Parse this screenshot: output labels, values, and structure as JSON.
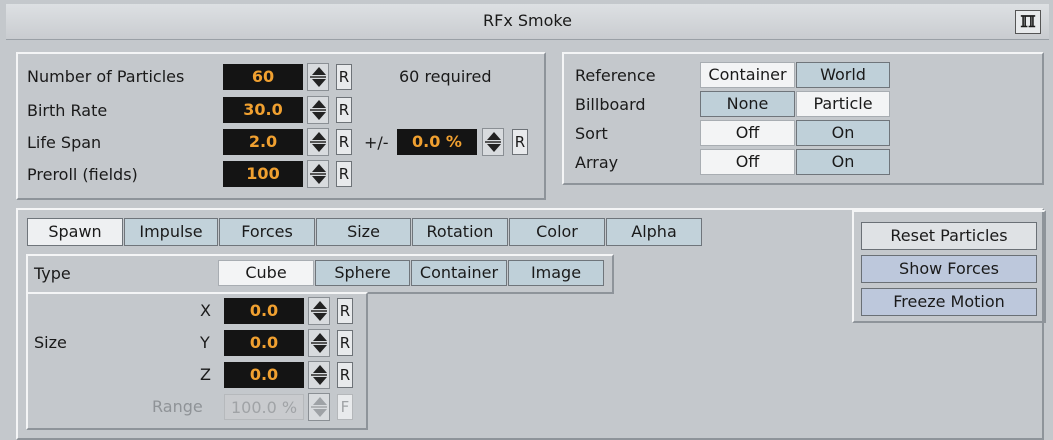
{
  "window": {
    "title": "RFx Smoke",
    "logo_glyph": "ℿ",
    "logo_icon": "vizrt-logo-icon"
  },
  "particles": {
    "rows": [
      {
        "label": "Number of Particles",
        "value": "60",
        "reset": "R"
      },
      {
        "label": "Birth Rate",
        "value": "30.0",
        "reset": "R"
      },
      {
        "label": "Life Span",
        "value": "2.0",
        "reset": "R"
      },
      {
        "label": "Preroll (fields)",
        "value": "100",
        "reset": "R"
      }
    ],
    "required_text": "60 required",
    "variance_label": "+/-",
    "variance_value": "0.0 %",
    "variance_reset": "R"
  },
  "options": {
    "rows": [
      {
        "label": "Reference",
        "a": "Container",
        "b": "World",
        "selected": "a"
      },
      {
        "label": "Billboard",
        "a": "None",
        "b": "Particle",
        "selected": "b"
      },
      {
        "label": "Sort",
        "a": "Off",
        "b": "On",
        "selected": "a"
      },
      {
        "label": "Array",
        "a": "Off",
        "b": "On",
        "selected": "a"
      }
    ]
  },
  "tabs": [
    "Spawn",
    "Impulse",
    "Forces",
    "Size",
    "Rotation",
    "Color",
    "Alpha"
  ],
  "active_tab": "Spawn",
  "spawn": {
    "type_label": "Type",
    "types": [
      "Cube",
      "Sphere",
      "Container",
      "Image"
    ],
    "active_type": "Cube",
    "size_label": "Size",
    "axes": [
      {
        "label": "X",
        "value": "0.0",
        "reset": "R"
      },
      {
        "label": "Y",
        "value": "0.0",
        "reset": "R"
      },
      {
        "label": "Z",
        "value": "0.0",
        "reset": "R"
      }
    ],
    "range": {
      "label": "Range",
      "value": "100.0 %",
      "reset": "F"
    }
  },
  "actions": {
    "reset_label": "Reset Particles",
    "show_forces_label": "Show Forces",
    "freeze_label": "Freeze Motion"
  },
  "colors": {
    "field_bg": "#141414",
    "field_text": "#f0a030",
    "selected_toggle": "#f3f4f5",
    "unselected_toggle": "#bfd0d9",
    "action_blue": "#bdc8dc"
  }
}
